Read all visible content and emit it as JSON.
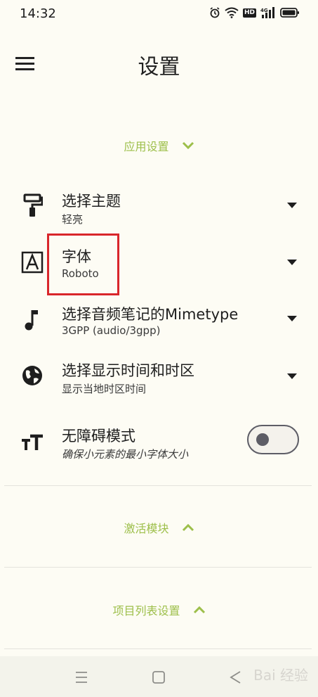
{
  "status": {
    "time": "14:32",
    "hd_label": "HD",
    "network_label": "4G"
  },
  "header": {
    "title": "设置"
  },
  "sections": {
    "app_settings": "应用设置",
    "activate_modules": "激活模块",
    "project_list_settings": "项目列表设置"
  },
  "settings": {
    "theme": {
      "title": "选择主题",
      "value": "轻亮"
    },
    "font": {
      "title": "字体",
      "value": "Roboto"
    },
    "audio_mimetype": {
      "title": "选择音频笔记的Mimetype",
      "value": "3GPP (audio/3gpp)"
    },
    "timezone": {
      "title": "选择显示时间和时区",
      "value": "显示当地时区时间"
    },
    "accessibility": {
      "title": "无障碍模式",
      "description": "确保小元素的最小字体大小",
      "enabled": false
    }
  },
  "colors": {
    "accent": "#9dbf4a",
    "highlight_box": "#d9262b",
    "background": "#fdfcf4"
  },
  "watermark": "Bai 经验"
}
